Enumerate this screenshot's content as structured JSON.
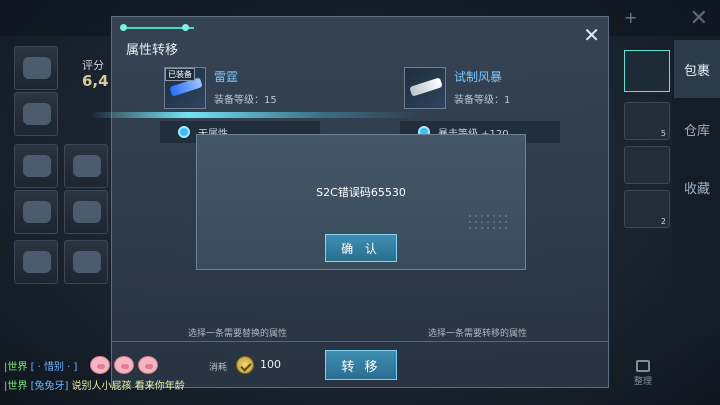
{
  "background": {
    "score_label": "评分",
    "score_value": "6,4",
    "tabs": [
      {
        "label": "包裹",
        "active": true
      },
      {
        "label": "仓库",
        "active": false
      },
      {
        "label": "收藏",
        "active": false
      }
    ],
    "item_counts": [
      "5",
      "2"
    ],
    "sort_label": "整理"
  },
  "dialog": {
    "title": "属性转移",
    "close_glyph": "✕",
    "left_equip": {
      "badge": "已装备",
      "name": "雷霆",
      "level_text": "装备等级：15",
      "attr_text": "无属性"
    },
    "right_equip": {
      "name": "试制风暴",
      "level_text": "装备等级：1",
      "attr_text": "暴击等级 +120"
    },
    "left_hint": "选择一条需要替换的属性",
    "right_hint": "选择一条需要转移的属性",
    "cost_label": "消耗",
    "cost_value": "100",
    "transfer_label": "转 移"
  },
  "popup": {
    "message": "S2C错误码65530",
    "confirm_label": "确 认"
  },
  "chat": [
    {
      "channel": "|世界",
      "name": "[ · 惜别 · ]",
      "message": ""
    },
    {
      "channel": "|世界",
      "name": "[兔兔牙]",
      "message": "说别人小屁孩  看来你年龄"
    }
  ],
  "colors": {
    "accent": "#4fd4c4",
    "button": "#2f7599",
    "equip_name": "#78c8ff",
    "chat_channel": "#7ee87a",
    "chat_name": "#6fb7ff"
  }
}
